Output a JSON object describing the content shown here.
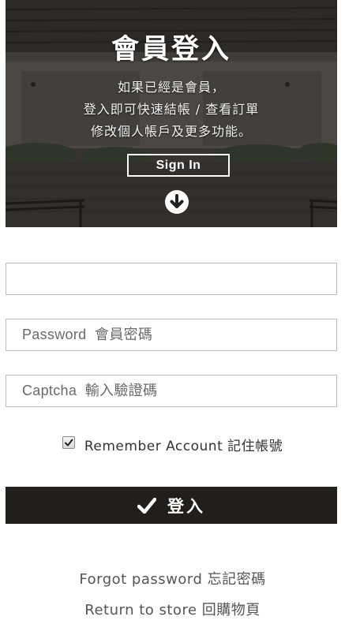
{
  "hero": {
    "title": "會員登入",
    "desc_lines": [
      "如果已經是會員，",
      "登入即可快速結帳 / 查看訂單",
      "修改個人帳戶及更多功能。"
    ],
    "signin_label": "Sign In",
    "icon": "arrow-down-circle-icon"
  },
  "form": {
    "account": {
      "value": "",
      "placeholder": ""
    },
    "password": {
      "value": "",
      "placeholder": "Password  會員密碼"
    },
    "captcha": {
      "value": "",
      "placeholder": "Captcha  輸入驗證碼"
    },
    "remember": {
      "label": "Remember Account 記住帳號",
      "checked": true
    },
    "submit": {
      "label": "登入",
      "icon": "checkmark-icon"
    }
  },
  "links": {
    "forgot": "Forgot password 忘記密碼",
    "return_store": "Return to store 回購物頁"
  },
  "colors": {
    "button_bg": "#221e1b",
    "hero_overlay": "#2d2a27",
    "field_border": "#bdbdbd"
  }
}
